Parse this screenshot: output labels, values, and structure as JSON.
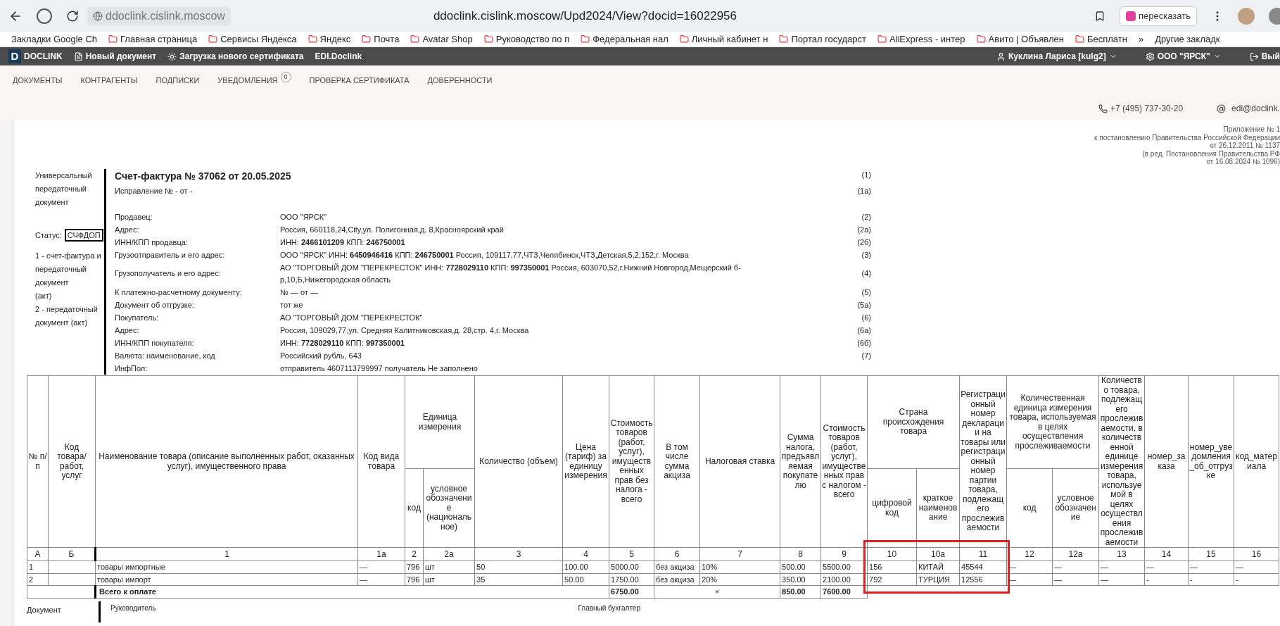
{
  "browser": {
    "site": "ddoclink.cislink.moscow",
    "url": "ddoclink.cislink.moscow/Upd2024/View?docid=16022956",
    "retell_button": "пересказать"
  },
  "bookmarks": [
    "Закладки Google Ch",
    "Главная страница",
    "Сервисы Яндекса",
    "Яндекс",
    "Почта",
    "Avatar Shop",
    "Руководство по п",
    "Федеральная нал",
    "Личный кабинет н",
    "Портал государст",
    "AliExpress - интер",
    "Авито | Объявлен",
    "Бесплатн"
  ],
  "bookmarks_overflow": "»",
  "other_bookmarks": "Другие закладк",
  "app_bar": {
    "logo_letter": "D",
    "logo": "DOCLINK",
    "actions": [
      "Новый документ",
      "Загрузка нового сертификата",
      "EDI.Doclink"
    ],
    "user": "Куклина Лариса [kulg2]",
    "org": "ООО \"ЯРСК\"",
    "exit": "Вый"
  },
  "nav": [
    {
      "label": "ДОКУМЕНТЫ"
    },
    {
      "label": "КОНТРАГЕНТЫ"
    },
    {
      "label": "ПОДПИСКИ"
    },
    {
      "label": "УВЕДОМЛЕНИЯ",
      "badge": "0"
    },
    {
      "label": "ПРОВЕРКА СЕРТИФИКАТА"
    },
    {
      "label": "ДОВЕРЕННОСТИ"
    }
  ],
  "contacts": {
    "phone": "+7 (495) 737-30-20",
    "email": "edi@doclink."
  },
  "annex": [
    "Приложение № 1",
    "к постановлению Правительства Российской Федерации",
    "от 26.12.2011 № 1137",
    "(в ред. Постановления Правительства РФ",
    "от 16.08.2024 № 1096)"
  ],
  "side": {
    "doc_type": "Универсальный передаточный документ",
    "status_label": "Статус:",
    "status": "СЧФДОП",
    "legend": [
      "1 - счет-фактура и передаточный документ",
      "(акт)",
      "2 - передаточный документ (акт)"
    ]
  },
  "invoice": {
    "title": "Счет-фактура № 37062  от 20.05.2025",
    "title_ref": "(1)",
    "correction": "Исправление № - от -",
    "correction_ref": "(1а)",
    "fields": [
      {
        "label": "Продавец:",
        "value": "ООО \"ЯРСК\"",
        "ref": "(2)"
      },
      {
        "label": "Адрес:",
        "value": "Россия, 660118,24,City,ул. Полигонная,д. 8,Красноярский край",
        "ref": "(2а)"
      },
      {
        "label": "ИНН/КПП продавца:",
        "value": "ИНН: **2466101209** КПП: **246750001**",
        "ref": "(2б)"
      },
      {
        "label": "Грузоотправитель и его адрес:",
        "value": "ООО \"ЯРСК\" ИНН: **6450946416** КПП: **246750001** Россия, 109117,77,ЧТЗ,Челябинск,ЧТЗ,Детская,5,2,152,г. Москва",
        "ref": "(3)"
      },
      {
        "label": "Грузополучатель и его адрес:",
        "value": "АО \"ТОРГОВЫЙ ДОМ \"ПЕРЕКРЕСТОК\" ИНН: **7728029110** КПП: **997350001** Россия, 603070,52,г.Нижний Новгород,Мещерский б-р,10,Б,Нижегородская область",
        "ref": "(4)"
      },
      {
        "label": "К платежно-расчетному документу:",
        "value": "№  — от —",
        "ref": "(5)"
      },
      {
        "label": "Документ об отгрузке:",
        "value": "тот же",
        "ref": "(5а)"
      },
      {
        "label": "Покупатель:",
        "value": "АО \"ТОРГОВЫЙ ДОМ \"ПЕРЕКРЕСТОК\"",
        "ref": "(6)"
      },
      {
        "label": "Адрес:",
        "value": "Россия, 109029,77,ул. Средняя Калитниковская,д. 28,стр. 4,г. Москва",
        "ref": "(6а)"
      },
      {
        "label": "ИНН/КПП покупателя:",
        "value": "ИНН: **7728029110** КПП: **997350001**",
        "ref": "(6б)"
      },
      {
        "label": "Валюта: наименование, код",
        "value": "Российский рубль,  643",
        "ref": "(7)"
      },
      {
        "label": "ИнфПол:",
        "value": "отправитель 4607113799997 получатель Не заполнено"
      }
    ]
  },
  "table": {
    "columns": [
      {
        "title": "№ п/п"
      },
      {
        "title": "Код товара/ работ, услуг"
      },
      {
        "title": "Наименование товара (описание выполненных работ, оказанных услуг), имущественного права"
      },
      {
        "title": "Код вида товара"
      },
      {
        "title": "Единица измерения",
        "colspan": 2,
        "children": [
          {
            "title": "код"
          },
          {
            "title": "условное обозначение (национальное)"
          }
        ]
      },
      {
        "title": "Количество (объем)"
      },
      {
        "title": "Цена (тариф) за единицу измерения"
      },
      {
        "title": "Стоимость товаров (работ, услуг), имущественных прав без налога - всего"
      },
      {
        "title": "В том числе сумма акциза"
      },
      {
        "title": "Налоговая ставка"
      },
      {
        "title": "Сумма налога, предъявляемая покупателю"
      },
      {
        "title": "Стоимость товаров (работ, услуг), имущественных прав с налогом - всего"
      },
      {
        "title": "Страна происхождения товара",
        "colspan": 2,
        "children": [
          {
            "title": "цифровой код"
          },
          {
            "title": "краткое наименование"
          }
        ]
      },
      {
        "title": "Регистрационный номер декларации на товары или регистрационный номер партии товара, подлежащего прослеживаемости"
      },
      {
        "title": "Количественная единица измерения товара, используемая в целях осуществления прослеживаемости",
        "colspan": 2,
        "children": [
          {
            "title": "код"
          },
          {
            "title": "условное обозначение"
          }
        ]
      },
      {
        "title": "Количество товара, подлежащего прослеживаемости, в количественной единице измерения товара, используемой в целях осуществления прослеживаемости"
      },
      {
        "title": "номер_заказа"
      },
      {
        "title": "номер_уведомления_об_отгрузке"
      },
      {
        "title": "код_материала"
      }
    ],
    "numbers": [
      "А",
      "Б",
      "1",
      "1а",
      "2",
      "2а",
      "3",
      "4",
      "5",
      "6",
      "7",
      "8",
      "9",
      "10",
      "10а",
      "11",
      "12",
      "12а",
      "13",
      "14",
      "15",
      "16"
    ],
    "rows": [
      [
        "1",
        null,
        "товары импортные",
        "—",
        "796",
        "шт",
        "50",
        "100.00",
        "5000.00",
        "без акциза",
        "10%",
        "500.00",
        "5500.00",
        "156",
        "КИТАЙ",
        "45544",
        "—",
        "—",
        "—",
        "—",
        "—",
        "—"
      ],
      [
        "2",
        null,
        "товары импорт",
        "—",
        "796",
        "шт",
        "35",
        "50.00",
        "1750.00",
        "без акциза",
        "20%",
        "350.00",
        "2100.00",
        "792",
        "ТУРЦИЯ",
        "12556",
        "—",
        "—",
        "—",
        "-",
        "-",
        "-"
      ]
    ],
    "total": {
      "label": "Всего к оплате",
      "sum_without_tax": "6750.00",
      "excise": "×",
      "tax": "850.00",
      "sum_with_tax": "7600.00"
    }
  },
  "footer": {
    "document": "Документ",
    "head": "Руководитель",
    "accountant": "Главный бухгалтер"
  }
}
